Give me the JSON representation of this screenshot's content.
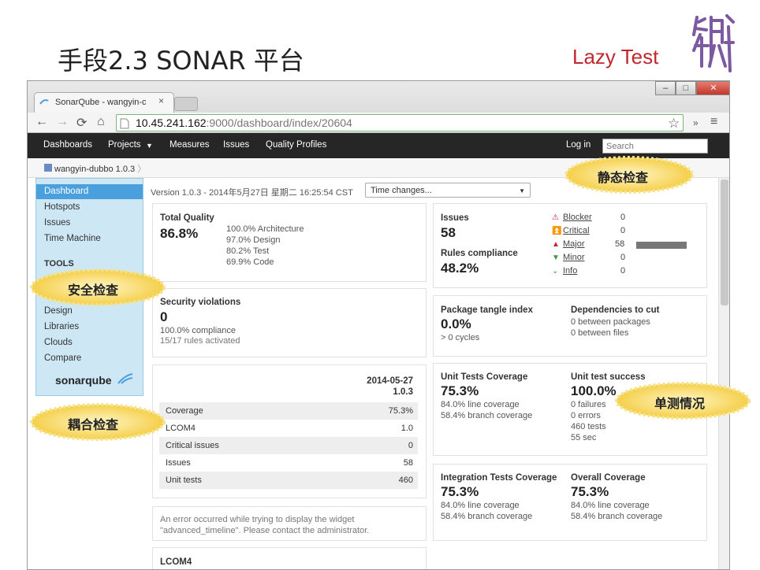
{
  "slide": {
    "title": "手段2.3  SONAR 平台",
    "brand": "Lazy Test"
  },
  "browser": {
    "tab_title": "SonarQube - wangyin-c",
    "url_host": "10.45.241.162",
    "url_rest": ":9000/dashboard/index/20604",
    "win_min": "‒",
    "win_max": "□",
    "win_close": "✕"
  },
  "nav": {
    "dashboards": "Dashboards",
    "projects": "Projects",
    "measures": "Measures",
    "issues": "Issues",
    "quality_profiles": "Quality Profiles",
    "login": "Log in",
    "search_placeholder": "Search"
  },
  "breadcrumb": "wangyin-dubbo 1.0.3",
  "sidebar": {
    "items": [
      "Dashboard",
      "Hotspots",
      "Issues",
      "Time Machine"
    ],
    "tools_header": "TOOLS",
    "tools": [
      "Design",
      "Libraries",
      "Clouds",
      "Compare"
    ],
    "logo": "sonarqube"
  },
  "version_line": "Version 1.0.3 - 2014年5月27日 星期二 16:25:54 CST",
  "time_changes": "Time changes...",
  "quality": {
    "label": "Total Quality",
    "value": "86.8%",
    "lines": [
      "100.0% Architecture",
      "97.0% Design",
      "80.2% Test",
      "69.9% Code"
    ]
  },
  "security": {
    "label": "Security violations",
    "value": "0",
    "compliance": "100.0% compliance",
    "rules": "15/17 rules activated"
  },
  "hist": {
    "date": "2014-05-27",
    "version": "1.0.3",
    "rows": [
      {
        "k": "Coverage",
        "v": "75.3%"
      },
      {
        "k": "LCOM4",
        "v": "1.0"
      },
      {
        "k": "Critical issues",
        "v": "0"
      },
      {
        "k": "Issues",
        "v": "58"
      },
      {
        "k": "Unit tests",
        "v": "460"
      }
    ]
  },
  "error_msg": {
    "l1": "An error occurred while trying to display the widget",
    "l2": "\"advanced_timeline\". Please contact the administrator."
  },
  "lcom_label": "LCOM4",
  "issues": {
    "label": "Issues",
    "value": "58",
    "rules_label": "Rules compliance",
    "rules_value": "48.2%",
    "severities": [
      {
        "name": "Blocker",
        "count": "0"
      },
      {
        "name": "Critical",
        "count": "0"
      },
      {
        "name": "Major",
        "count": "58"
      },
      {
        "name": "Minor",
        "count": "0"
      },
      {
        "name": "Info",
        "count": "0"
      }
    ]
  },
  "tangle": {
    "label": "Package tangle index",
    "value": "0.0%",
    "cycles": "> 0 cycles",
    "dep_label": "Dependencies to cut",
    "dep1": "0 between packages",
    "dep2": "0 between files"
  },
  "unit": {
    "label": "Unit Tests Coverage",
    "value": "75.3%",
    "line": "84.0% line coverage",
    "branch": "58.4% branch coverage",
    "success_label": "Unit test success",
    "success_value": "100.0%",
    "failures": "0 failures",
    "errors": "0 errors",
    "tests": "460 tests",
    "time": "55 sec"
  },
  "integ": {
    "label": "Integration Tests Coverage",
    "value": "75.3%",
    "line": "84.0% line coverage",
    "branch": "58.4% branch coverage",
    "overall_label": "Overall Coverage",
    "overall_value": "75.3%",
    "overall_line": "84.0% line coverage",
    "overall_branch": "58.4% branch coverage"
  },
  "callouts": {
    "static": "静态检查",
    "security": "安全检查",
    "coupling": "耦合检查",
    "unit": "单测情况"
  },
  "colors": {
    "accent": "#4aa0dc",
    "nav_bg": "#262626",
    "brand": "#c0282e",
    "callout": "#f9e27a"
  }
}
